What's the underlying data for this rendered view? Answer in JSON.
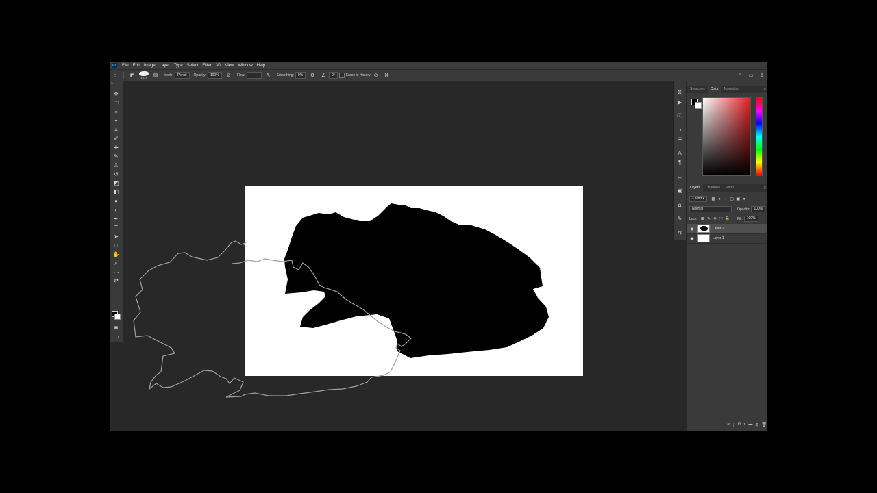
{
  "app": {
    "logo": "Ps"
  },
  "menu": [
    "File",
    "Edit",
    "Image",
    "Layer",
    "Type",
    "Select",
    "Filter",
    "3D",
    "View",
    "Window",
    "Help"
  ],
  "options": {
    "brush_size": "1313",
    "mode_label": "Mode:",
    "mode_value": "Pencil",
    "opacity_label": "Opacity:",
    "opacity_value": "100%",
    "flow_label": "Flow:",
    "smoothing_label": "Smoothing:",
    "smoothing_value": "0%",
    "angle_value": "0°",
    "erase_history_label": "Erase to History"
  },
  "panels": {
    "color_tabs": [
      {
        "label": "Swatches",
        "active": false
      },
      {
        "label": "Color",
        "active": true
      },
      {
        "label": "Navigator",
        "active": false
      }
    ],
    "layers_tabs": [
      {
        "label": "Layers",
        "active": true
      },
      {
        "label": "Channels",
        "active": false
      },
      {
        "label": "Paths",
        "active": false
      }
    ],
    "kind_label": "Kind",
    "blend_mode": "Normal",
    "opacity_label": "Opacity:",
    "opacity_value": "100%",
    "lock_label": "Lock:",
    "fill_label": "Fill:",
    "fill_value": "100%",
    "layers": [
      {
        "name": "Layer 2",
        "selected": true,
        "has_shape": true
      },
      {
        "name": "Layer 1",
        "selected": false,
        "has_shape": false
      }
    ]
  },
  "colors": {
    "foreground": "#000000",
    "background": "#ffffff",
    "workspace": "#282828",
    "panel": "#3a3a3a",
    "outline": "#a0a0a0"
  }
}
